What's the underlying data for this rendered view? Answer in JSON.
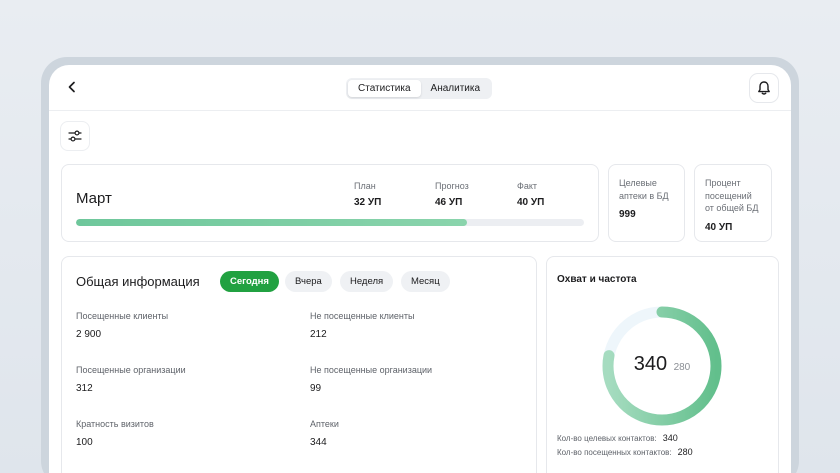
{
  "header": {
    "tabs": [
      {
        "label": "Статистика",
        "active": true
      },
      {
        "label": "Аналитика",
        "active": false
      }
    ],
    "icons": {
      "back": "chevron-left-icon",
      "notifications": "bell-icon",
      "filter": "sliders-icon"
    }
  },
  "plan_card": {
    "month": "Март",
    "stats": [
      {
        "label": "План",
        "value": "32 УП"
      },
      {
        "label": "Прогноз",
        "value": "46 УП"
      },
      {
        "label": "Факт",
        "value": "40 УП"
      }
    ],
    "progress_percent": 77
  },
  "side_cards": [
    {
      "label_lines": [
        "Целевые",
        "аптеки в БД"
      ],
      "value": "999"
    },
    {
      "label_lines": [
        "Процент",
        "посещений",
        "от общей БД"
      ],
      "value": "40 УП"
    }
  ],
  "info": {
    "title": "Общая информация",
    "periods": [
      {
        "label": "Сегодня",
        "active": true
      },
      {
        "label": "Вчера",
        "active": false
      },
      {
        "label": "Неделя",
        "active": false
      },
      {
        "label": "Месяц",
        "active": false
      }
    ],
    "metrics": [
      {
        "label": "Посещенные клиенты",
        "value": "2 900"
      },
      {
        "label": "Не посещенные клиенты",
        "value": "212"
      },
      {
        "label": "Посещенные организации",
        "value": "312"
      },
      {
        "label": "Не посещенные организации",
        "value": "99"
      },
      {
        "label": "Кратность визитов",
        "value": "100"
      },
      {
        "label": "Аптеки",
        "value": "344"
      }
    ]
  },
  "reach": {
    "title": "Охват и частота",
    "big_value": "340",
    "small_value": "280",
    "ring_fraction": 0.78,
    "lines": [
      {
        "label": "Кол-во целевых контактов:",
        "value": "340"
      },
      {
        "label": "Кол-во посещенных контактов:",
        "value": "280"
      }
    ]
  },
  "colors": {
    "accent_green": "#21a141",
    "progress_green": "#6ec79b",
    "ring_track": "#eef6fb"
  }
}
